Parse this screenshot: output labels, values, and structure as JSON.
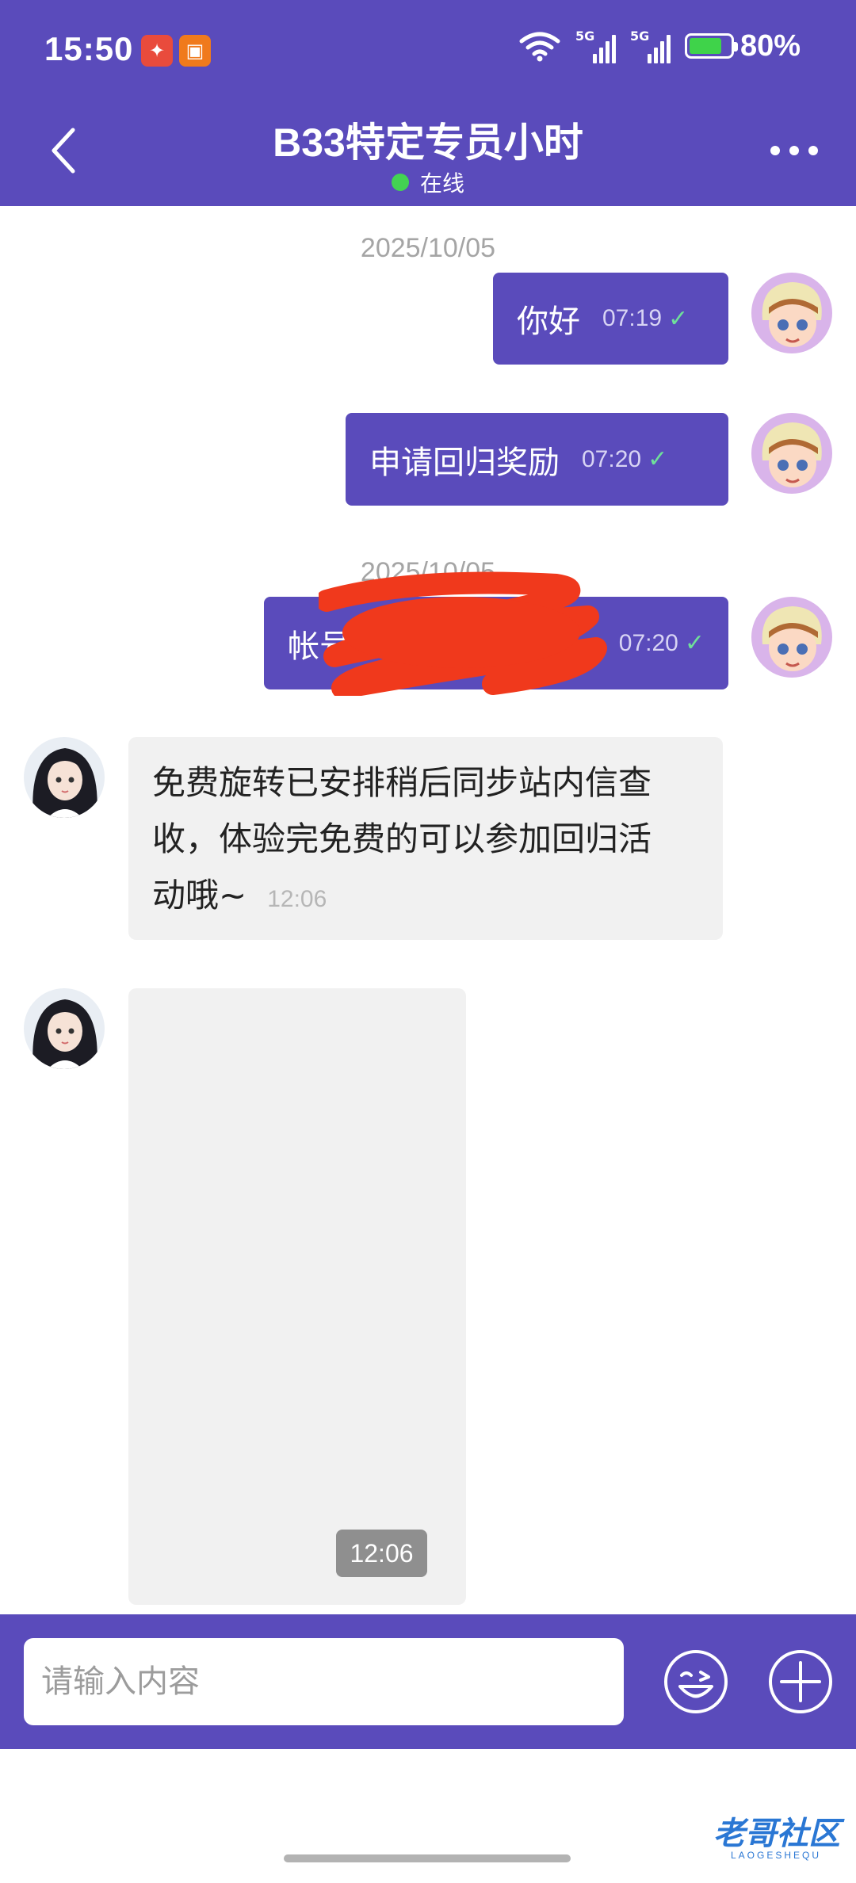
{
  "status_bar": {
    "time": "15:50",
    "network_1": "5G",
    "network_2": "5G",
    "battery": "80%"
  },
  "header": {
    "title": "B33特定专员小时",
    "status": "在线"
  },
  "messages": [
    {
      "type": "date",
      "text": "2025/10/05"
    },
    {
      "type": "out",
      "text": "你好",
      "time": "07:19"
    },
    {
      "type": "out",
      "text": "申请回归奖励",
      "time": "07:20"
    },
    {
      "type": "date",
      "text": "2025/10/05"
    },
    {
      "type": "out",
      "text": "帐号",
      "time": "07:20",
      "redacted": true
    },
    {
      "type": "in",
      "lines": [
        "免费旋转已安排稍后同步站内信查",
        "收，体验完免费的可以参加回归活",
        "动哦~"
      ],
      "time": "12:06"
    },
    {
      "type": "in-image",
      "time": "12:06"
    }
  ],
  "input": {
    "placeholder": "请输入内容"
  },
  "icons": {
    "back": "back-arrow-icon",
    "more": "more-icon",
    "emoji": "emoji-icon",
    "add": "add-icon",
    "check": "check-icon"
  },
  "colors": {
    "brand": "#5a4bbb",
    "online": "#43d352",
    "incoming_bubble": "#f1f1f1"
  },
  "watermark": {
    "text": "老哥社区",
    "sub": "LAOGESHEQU"
  }
}
